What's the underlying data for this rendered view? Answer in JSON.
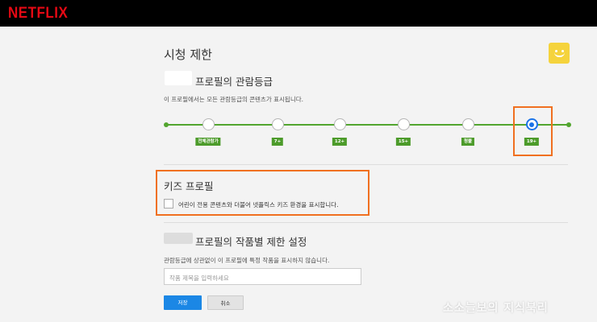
{
  "brand": {
    "logo_text": "NETFLIX",
    "logo_color": "#e50914"
  },
  "page": {
    "title": "시청 제한"
  },
  "avatar": {
    "icon": "smiley-face-icon",
    "color": "#f5d33c"
  },
  "maturity": {
    "title": "프로필의 관람등급",
    "description": "이 프로필에서는 모든 관람등급의 콘텐츠가 표시됩니다.",
    "selected": "19+",
    "levels": [
      "전체관람가",
      "7+",
      "12+",
      "15+",
      "청불",
      "19+"
    ]
  },
  "kids": {
    "title": "키즈 프로필",
    "checkbox_label": "어린이 전용 콘텐츠와 더불어 넷플릭스 키즈 환경을 표시합니다.",
    "checked": false
  },
  "title_restrictions": {
    "title": "프로필의 작품별 제한 설정",
    "description": "관람등급에 상관없이 이 프로필에 특정 작품을 표시하지 않습니다.",
    "input_placeholder": "작품 제목을 입력하세요"
  },
  "buttons": {
    "save": "저장",
    "cancel": "취소"
  },
  "watermark": "소소늘보의 지식북리",
  "colors": {
    "accent_green": "#52a52e",
    "selected_blue": "#1a73e8",
    "highlight_orange": "#f07020",
    "save_blue": "#1b87e5"
  }
}
